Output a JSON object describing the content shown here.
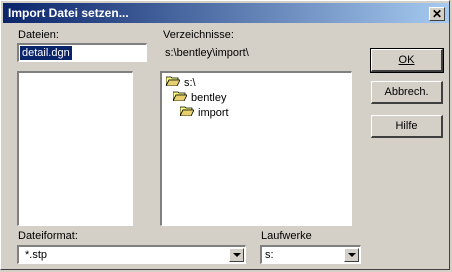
{
  "window": {
    "title": "Import Datei setzen...",
    "close_label": "✕"
  },
  "files": {
    "label": "Dateien:",
    "name_value": "detail.dgn"
  },
  "directories": {
    "label": "Verzeichnisse:",
    "current_path": "s:\\bentley\\import\\",
    "tree": [
      {
        "label": "s:\\",
        "depth": 0
      },
      {
        "label": "bentley",
        "depth": 1
      },
      {
        "label": "import",
        "depth": 2
      }
    ]
  },
  "buttons": {
    "ok": "OK",
    "cancel": "Abbrech.",
    "help": "Hilfe"
  },
  "file_format": {
    "label": "Dateiformat:",
    "value": "*.stp"
  },
  "drives": {
    "label": "Laufwerke",
    "value": "s:"
  },
  "colors": {
    "titlebar_start": "#0a246a",
    "titlebar_end": "#a6caf0",
    "face": "#d4d0c8",
    "selection": "#0a246a"
  }
}
